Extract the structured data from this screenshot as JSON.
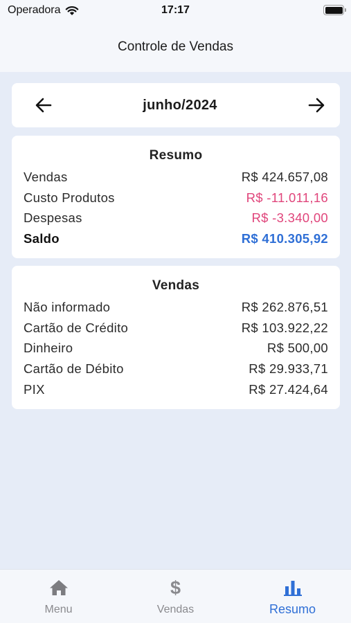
{
  "status_bar": {
    "carrier": "Operadora",
    "time": "17:17"
  },
  "header": {
    "title": "Controle de Vendas"
  },
  "month_selector": {
    "label": "junho/2024"
  },
  "summary": {
    "title": "Resumo",
    "rows": [
      {
        "label": "Vendas",
        "value": "R$ 424.657,08"
      },
      {
        "label": "Custo Produtos",
        "value": "R$ -11.011,16"
      },
      {
        "label": "Despesas",
        "value": "R$ -3.340,00"
      },
      {
        "label": "Saldo",
        "value": "R$ 410.305,92"
      }
    ]
  },
  "sales": {
    "title": "Vendas",
    "rows": [
      {
        "label": "Não informado",
        "value": "R$ 262.876,51"
      },
      {
        "label": "Cartão de Crédito",
        "value": "R$ 103.922,22"
      },
      {
        "label": "Dinheiro",
        "value": "R$ 500,00"
      },
      {
        "label": "Cartão de Débito",
        "value": "R$ 29.933,71"
      },
      {
        "label": "PIX",
        "value": "R$ 27.424,64"
      }
    ]
  },
  "tab_bar": {
    "tabs": [
      {
        "label": "Menu",
        "icon": "home-icon"
      },
      {
        "label": "Vendas",
        "icon": "dollar-icon"
      },
      {
        "label": "Resumo",
        "icon": "bar-chart-icon"
      }
    ],
    "active_tab": "Resumo"
  },
  "colors": {
    "accent": "#2f6fd6",
    "negative": "#e0457b",
    "background": "#e6ecf7"
  }
}
